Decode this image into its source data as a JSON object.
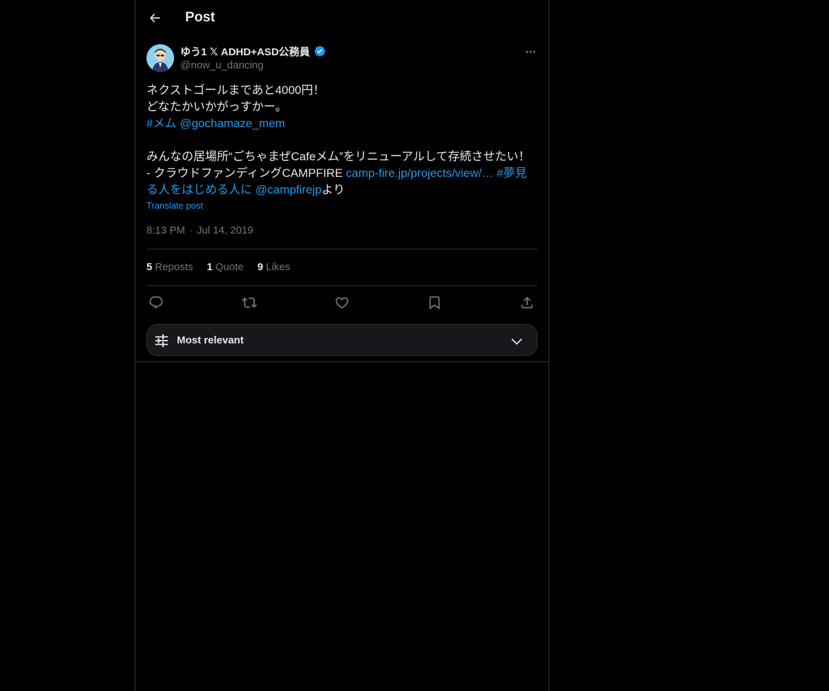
{
  "header": {
    "title": "Post",
    "back_icon": "arrow-left-icon"
  },
  "post": {
    "author": {
      "name": "ゆう1 𝕏 ADHD+ASD公務員",
      "handle": "@now_u_dancing",
      "verified": true
    },
    "text": {
      "line1": "ネクストゴールまであと4000円！",
      "line2": "どなたかいかがっすかー。",
      "hashtag1": "#メム",
      "mention1": "@gochamaze_mem",
      "line4": "みんなの居場所“ごちゃまぜCafeメム”をリニューアルして存続させたい！",
      "line5_prefix": "- クラウドファンディングCAMPFIRE ",
      "url": "camp-fire.jp/projects/view/…",
      "hashtag2": "#夢見る人をはじめる人に",
      "mention2": "@campfirejp",
      "suffix": "より"
    },
    "translate_label": "Translate post",
    "time": "8:13 PM",
    "separator": "·",
    "date": "Jul 14, 2019",
    "stats": {
      "reposts_count": "5",
      "reposts_label": "Reposts",
      "quotes_count": "1",
      "quotes_label": "Quote",
      "likes_count": "9",
      "likes_label": "Likes"
    },
    "actions": [
      "reply-icon",
      "repost-icon",
      "like-icon",
      "bookmark-icon",
      "share-icon"
    ]
  },
  "sort": {
    "label": "Most relevant"
  },
  "colors": {
    "background": "#000000",
    "text": "#e7e9ea",
    "secondary": "#71767b",
    "accent": "#1d9bf0",
    "border": "#2f3336"
  }
}
